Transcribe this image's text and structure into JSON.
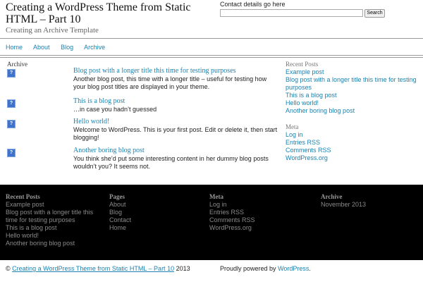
{
  "header": {
    "site_title": "Creating a WordPress Theme from Static HTML – Part 10",
    "site_description": "Creating an Archive Template",
    "contact": "Contact details go here",
    "search_value": "",
    "search_button": "Search"
  },
  "nav": {
    "items": [
      "Home",
      "About",
      "Blog",
      "Archive"
    ]
  },
  "main": {
    "heading": "Archive",
    "posts": [
      {
        "title": "Blog post with a longer title this time for testing purposes",
        "excerpt": "Another blog post, this time with a longer title – useful for testing how your blog post titles are displayed in your theme.",
        "icon": "?"
      },
      {
        "title": "This is a blog post",
        "excerpt": "…in case you hadn’t guessed",
        "icon": "?"
      },
      {
        "title": "Hello world!",
        "excerpt": "Welcome to WordPress. This is your first post. Edit or delete it, then start blogging!",
        "icon": "?"
      },
      {
        "title": "Another boring blog post",
        "excerpt": "You think she’d put some interesting content in her dummy blog posts wouldn’t you? It seems not.",
        "icon": "?"
      }
    ]
  },
  "sidebar": {
    "recent_heading": "Recent Posts",
    "recent": [
      "Example post",
      "Blog post with a longer title this time for testing purposes",
      "This is a blog post",
      "Hello world!",
      "Another boring blog post"
    ],
    "meta_heading": "Meta",
    "meta": [
      "Log in",
      "Entries RSS",
      "Comments RSS",
      "WordPress.org"
    ]
  },
  "footer": {
    "recent_heading": "Recent Posts",
    "recent": [
      "Example post",
      "Blog post with a longer title this time for testing purposes",
      "This is a blog post",
      "Hello world!",
      "Another boring blog post"
    ],
    "pages_heading": "Pages",
    "pages": [
      "About",
      "Blog",
      "Contact",
      "Home"
    ],
    "meta_heading": "Meta",
    "meta": [
      "Log in",
      "Entries RSS",
      "Comments RSS",
      "WordPress.org"
    ],
    "archive_heading": "Archive",
    "archive": [
      "November 2013"
    ]
  },
  "bottom": {
    "copyright": "©",
    "copyright_link": "Creating a WordPress Theme from Static HTML – Part 10",
    "year": "2013",
    "powered_prefix": "Proudly powered by",
    "powered_link": "WordPress",
    "powered_suffix": "."
  }
}
